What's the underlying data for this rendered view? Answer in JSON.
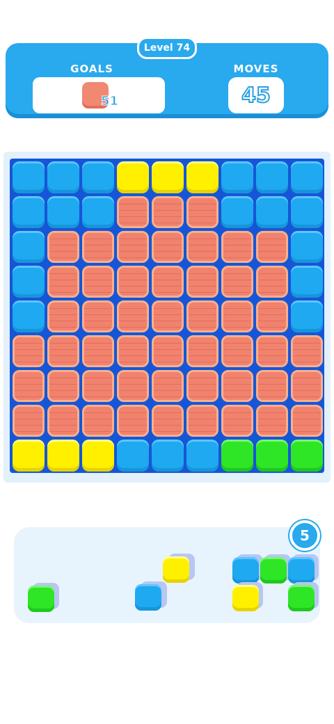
{
  "header": {
    "level_label": "Level 74",
    "goals_label": "GOALS",
    "goal_count": "51",
    "moves_label": "MOVES",
    "moves_value": "45"
  },
  "tray": {
    "pieces_left": "5"
  },
  "board": {
    "rows": [
      [
        "blue",
        "blue",
        "blue",
        "yellow",
        "yellow",
        "yellow",
        "blue",
        "blue",
        "blue"
      ],
      [
        "blue",
        "blue",
        "blue",
        "red",
        "red",
        "red",
        "blue",
        "blue",
        "blue"
      ],
      [
        "blue",
        "red",
        "red",
        "red",
        "red",
        "red",
        "red",
        "red",
        "blue"
      ],
      [
        "blue",
        "red",
        "red",
        "red",
        "red",
        "red",
        "red",
        "red",
        "blue"
      ],
      [
        "blue",
        "red",
        "red",
        "red",
        "red",
        "red",
        "red",
        "red",
        "blue"
      ],
      [
        "red",
        "red",
        "red",
        "red",
        "red",
        "red",
        "red",
        "red",
        "red"
      ],
      [
        "red",
        "red",
        "red",
        "red",
        "red",
        "red",
        "red",
        "red",
        "red"
      ],
      [
        "red",
        "red",
        "red",
        "red",
        "red",
        "red",
        "red",
        "red",
        "red"
      ],
      [
        "yellow",
        "yellow",
        "yellow",
        "blue",
        "blue",
        "blue",
        "green",
        "green",
        "green"
      ]
    ]
  },
  "colors": {
    "blue": "#1fa9f0",
    "yellow": "#fff000",
    "green": "#2ee626",
    "red": "#f0826e",
    "board_bg": "#1656d6",
    "header_bg": "#29a9ee"
  },
  "pieces": [
    {
      "name": "piece-1",
      "cells": [
        "green"
      ]
    },
    {
      "name": "piece-2",
      "cells": [
        "yellow",
        "blue"
      ]
    },
    {
      "name": "piece-3",
      "cells": [
        "blue",
        "green",
        "blue",
        "yellow",
        "green"
      ]
    }
  ]
}
